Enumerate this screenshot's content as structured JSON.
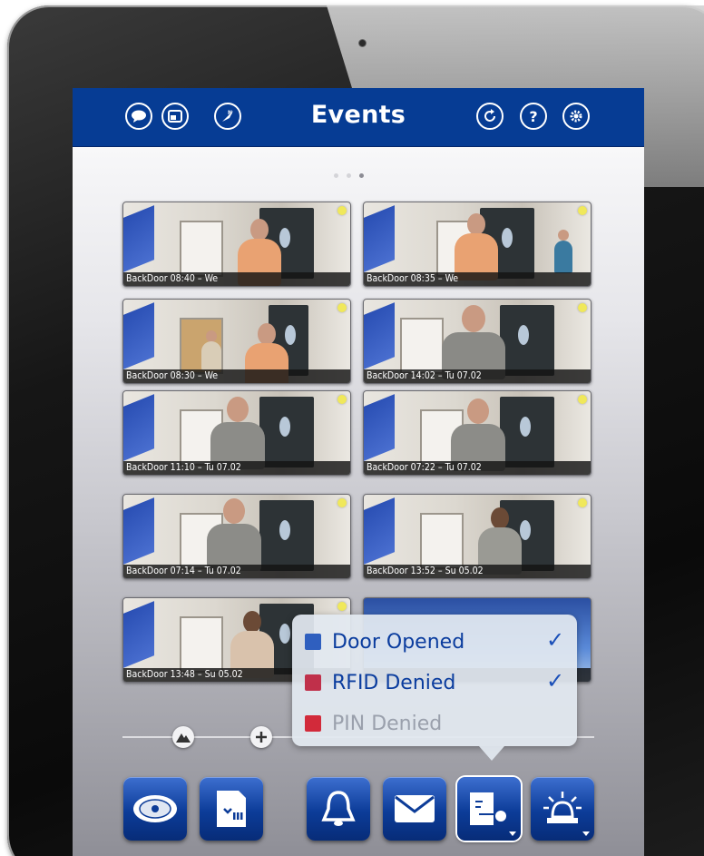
{
  "topbar": {
    "title": "Events",
    "left_icons": [
      "chat-icon",
      "window-icon",
      "compass-icon"
    ],
    "right_icons": [
      "refresh-icon",
      "help-icon",
      "settings-icon"
    ],
    "help_glyph": "?"
  },
  "pager": {
    "pages": 3,
    "active": 3
  },
  "events": [
    {
      "caption": "BackDoor 08:40 – We"
    },
    {
      "caption": "BackDoor 08:35 – We"
    },
    {
      "caption": "BackDoor 08:30 – We"
    },
    {
      "caption": "BackDoor 14:02 – Tu 07.02"
    },
    {
      "caption": "BackDoor 11:10 – Tu 07.02"
    },
    {
      "caption": "BackDoor 07:22 – Tu 07.02"
    },
    {
      "caption": "BackDoor 07:14 – Tu 07.02"
    },
    {
      "caption": "BackDoor 13:52 – Su 05.02"
    },
    {
      "caption": "BackDoor 13:48 – Su 05.02"
    },
    {
      "caption": ""
    }
  ],
  "filter_popup": {
    "items": [
      {
        "label": "Door Opened",
        "checked": true,
        "icon": "door-icon",
        "color": "#2f5fbf"
      },
      {
        "label": "RFID Denied",
        "checked": true,
        "icon": "rfid-icon",
        "color": "#c0304a"
      },
      {
        "label": "PIN Denied",
        "checked": false,
        "icon": "keypad-icon",
        "color": "#d22a3a"
      }
    ],
    "check_glyph": "✓"
  },
  "toolbar": {
    "buttons": [
      "camera-dome-icon",
      "sd-card-icon",
      "bell-icon",
      "mail-icon",
      "door-key-icon",
      "alarm-light-icon"
    ]
  },
  "colors": {
    "brand": "#063c94",
    "accent": "#1a4fb8"
  }
}
